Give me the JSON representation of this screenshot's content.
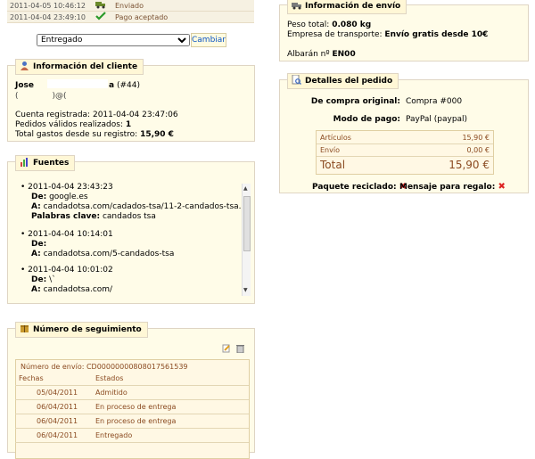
{
  "history": {
    "rows": [
      {
        "date": "2011-04-05 10:46:12",
        "status": "Enviado"
      },
      {
        "date": "2011-04-04 23:49:10",
        "status": "Pago aceptado"
      }
    ]
  },
  "state_form": {
    "selected": "Entregado",
    "button_label": "Cambiar"
  },
  "customer": {
    "legend": "Información del cliente",
    "name": "Jose",
    "name_suffix": "a",
    "id_label": "(#44)",
    "email": "@",
    "registered_label": "Cuenta registrada:",
    "registered_value": "2011-04-04 23:47:06",
    "orders_label": "Pedidos válidos realizados:",
    "orders_value": "1",
    "total_label": "Total gastos desde su registro:",
    "total_value": "15,90 €"
  },
  "sources": {
    "legend": "Fuentes",
    "items": [
      {
        "date": "2011-04-04 23:43:23",
        "de_label": "De:",
        "de_value": "google.es",
        "a_label": "A:",
        "a_value": "candadotsa.com/cadados-tsa/11-2-candados-tsa.html",
        "kw_label": "Palabras clave:",
        "kw_value": "candados tsa"
      },
      {
        "date": "2011-04-04 10:14:01",
        "de_label": "De:",
        "de_value": "",
        "a_label": "A:",
        "a_value": "candadotsa.com/5-candados-tsa"
      },
      {
        "date": "2011-04-04 10:01:02",
        "de_label": "De:",
        "de_value": "\\`",
        "a_label": "A:",
        "a_value": "candadotsa.com/"
      }
    ]
  },
  "tracking": {
    "legend": "Número de seguimiento",
    "number_label": "Número de envío:",
    "number_value": "CD00000000808017561539",
    "col_date": "Fechas",
    "col_status": "Estados",
    "rows": [
      {
        "date": "05/04/2011",
        "status": "Admitido"
      },
      {
        "date": "06/04/2011",
        "status": "En proceso de entrega"
      },
      {
        "date": "06/04/2011",
        "status": "En proceso de entrega"
      },
      {
        "date": "06/04/2011",
        "status": "Entregado"
      }
    ]
  },
  "shipping": {
    "legend": "Información de envío",
    "weight_label": "Peso total:",
    "weight_value": "0.080 kg",
    "carrier_label": "Empresa de transporte:",
    "carrier_value": "Envío gratis desde 10€",
    "albaran_label": "Albarán nº",
    "albaran_value": "EN00"
  },
  "order": {
    "legend": "Detalles del pedido",
    "original_label": "De compra original:",
    "original_value": "Compra #000",
    "payment_label": "Modo de pago:",
    "payment_value": "PayPal (paypal)",
    "articles_label": "Artículos",
    "articles_value": "15,90 €",
    "shipping_label": "Envío",
    "shipping_value": "0,00 €",
    "total_label": "Total",
    "total_value": "15,90 €",
    "recycled_label": "Paquete reciclado:",
    "gift_label": "Mensaje para regalo:"
  },
  "colors": {
    "panel_bg": "#fffce8",
    "panel_border": "#dfd5c3",
    "link_blue": "#0b55c4",
    "accent_brown": "#8a4a20",
    "red_x": "#dd2222"
  }
}
